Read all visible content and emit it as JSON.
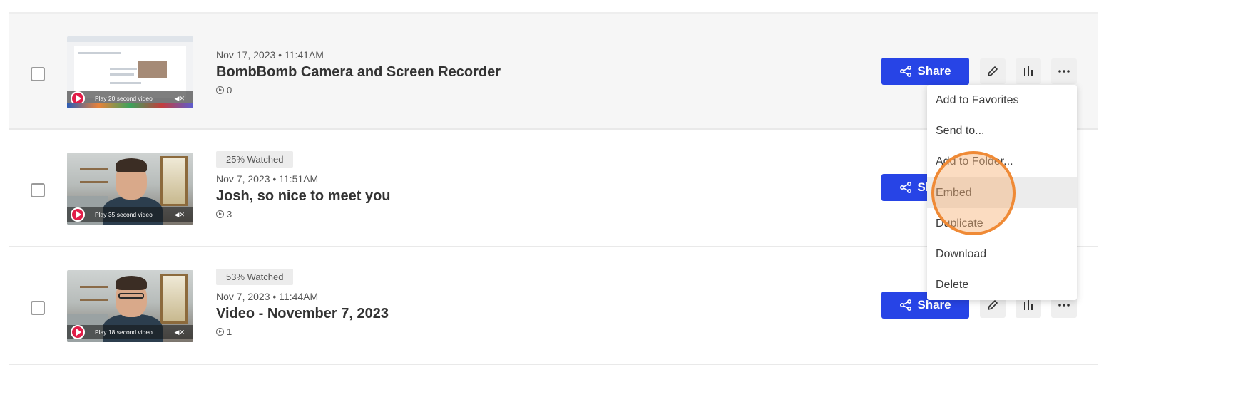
{
  "rows": [
    {
      "badge": "",
      "date": "Nov 17, 2023 • 11:41AM",
      "title": "BombBomb Camera and Screen Recorder",
      "views": "0",
      "play_label": "Play 20 second video",
      "share_label": "Share"
    },
    {
      "badge": "25% Watched",
      "date": "Nov 7, 2023 • 11:51AM",
      "title": "Josh, so nice to meet you",
      "views": "3",
      "play_label": "Play 35 second video",
      "share_label": "Share"
    },
    {
      "badge": "53% Watched",
      "date": "Nov 7, 2023 • 11:44AM",
      "title": "Video - November 7, 2023",
      "views": "1",
      "play_label": "Play 18 second video",
      "share_label": "Share"
    }
  ],
  "menu": {
    "items": [
      {
        "label": "Add to Favorites"
      },
      {
        "label": "Send to..."
      },
      {
        "label": "Add to Folder..."
      },
      {
        "label": "Embed"
      },
      {
        "label": "Duplicate"
      },
      {
        "label": "Download"
      },
      {
        "label": "Delete"
      }
    ],
    "hovered": "Embed"
  },
  "colors": {
    "share_button": "#2744e6",
    "click_indicator": "#ef8a36",
    "play_button": "#e11d48"
  },
  "icons": {
    "share": "share-icon",
    "edit": "pencil-icon",
    "analytics": "bar-chart-icon",
    "more": "more-dots-icon",
    "views": "play-circle-icon"
  }
}
